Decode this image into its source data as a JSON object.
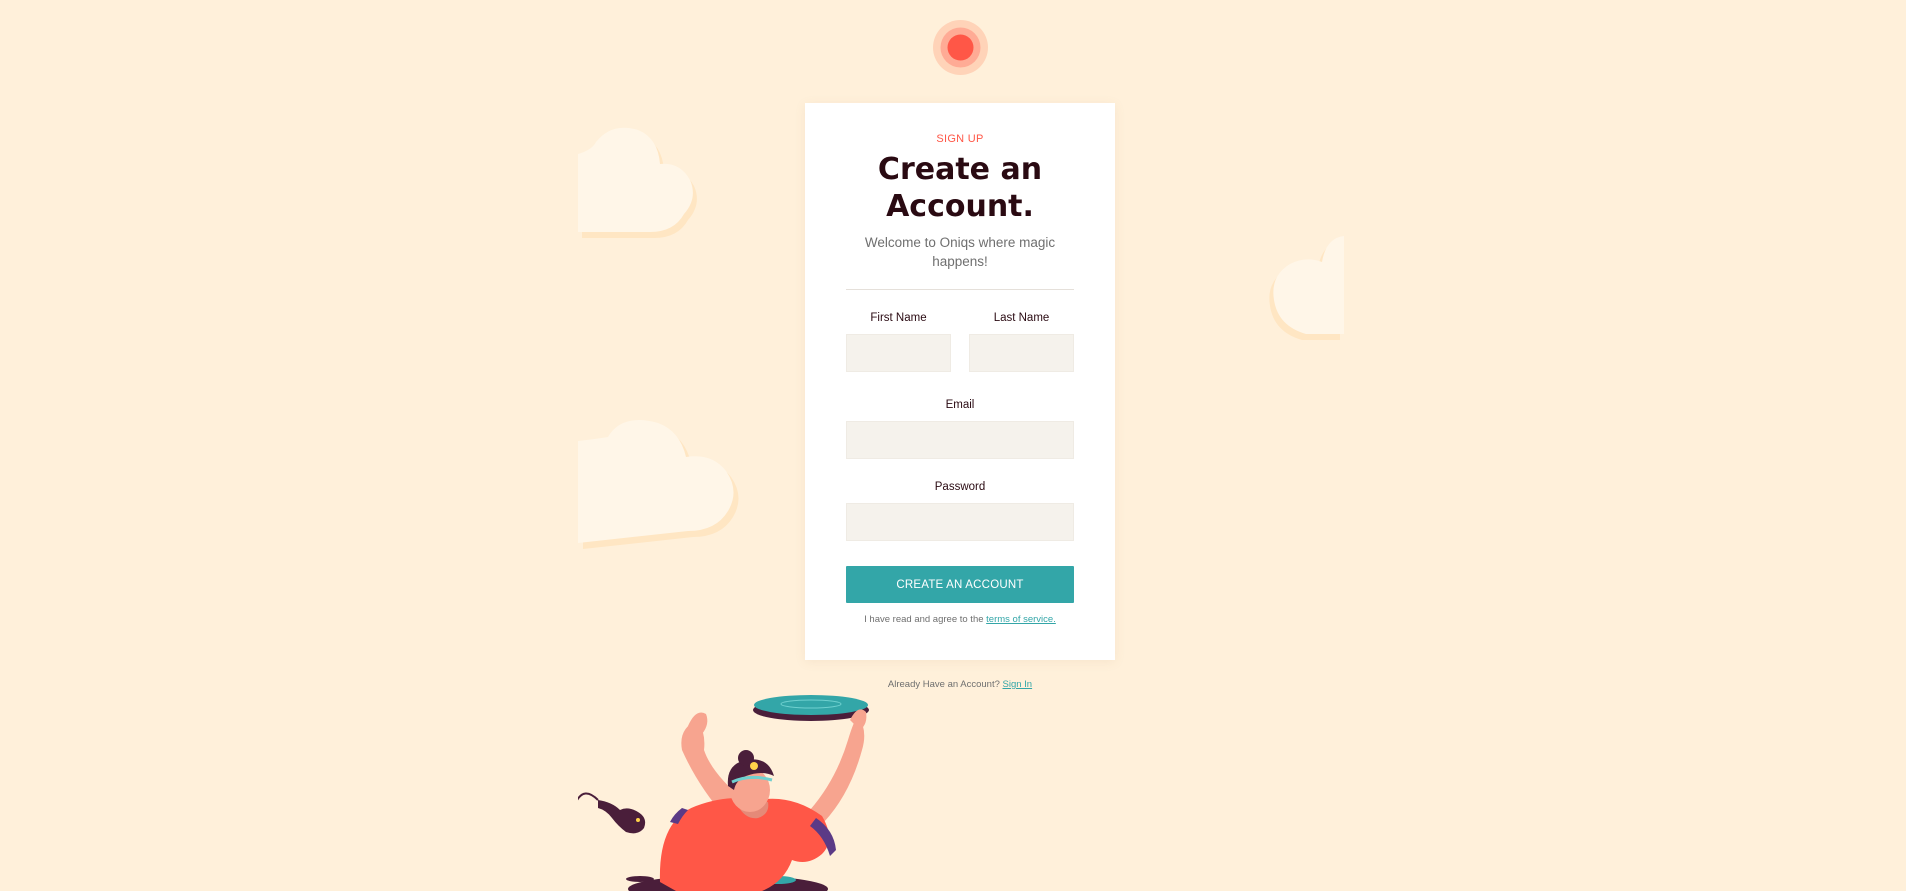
{
  "brand": {
    "logo_icon": "brand-logo-icon",
    "accent_color": "#ff5747",
    "primary_color": "#33a6a8",
    "background_color": "#fff0da"
  },
  "form": {
    "eyebrow": "SIGN UP",
    "title_line1": "Create an",
    "title_line2": "Account.",
    "subtitle": "Welcome to Oniqs where magic happens!",
    "first_name": {
      "label": "First Name",
      "value": "",
      "placeholder": ""
    },
    "last_name": {
      "label": "Last Name",
      "value": "",
      "placeholder": ""
    },
    "email": {
      "label": "Email",
      "value": "",
      "placeholder": ""
    },
    "password": {
      "label": "Password",
      "value": "",
      "placeholder": ""
    },
    "submit_label": "CREATE AN ACCOUNT",
    "terms_text": "I have read and agree to the",
    "terms_link": "terms of service."
  },
  "footer": {
    "signin_text": "Already Have an Account?",
    "signin_link": "Sign In"
  }
}
